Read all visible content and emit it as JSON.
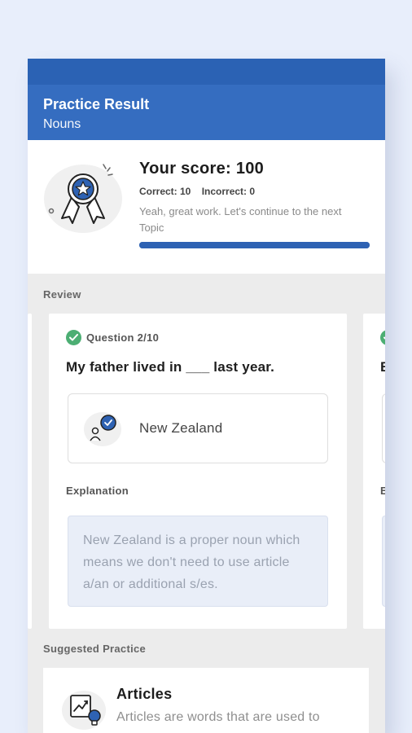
{
  "header": {
    "title": "Practice Result",
    "subtitle": "Nouns"
  },
  "score": {
    "title": "Your score: 100",
    "correct": "Correct: 10",
    "incorrect": "Incorrect: 0",
    "message": "Yeah, great work. Let's continue to the next Topic",
    "progress": 1.0
  },
  "review": {
    "label": "Review",
    "cards": [
      {
        "question_number": "Question 2/10",
        "question": "My father lived in ___ last year.",
        "answer": "New Zealand",
        "explanation_label": "Explanation",
        "explanation": "New Zealand is a proper noun which means we don't need to use article a/an or additional s/es."
      },
      {
        "question_fragment": "B",
        "explanation_fragment": "E"
      }
    ]
  },
  "suggested": {
    "label": "Suggested Practice",
    "items": [
      {
        "title": "Articles",
        "description": "Articles are words that are used to"
      }
    ]
  },
  "colors": {
    "primary": "#356dc0",
    "status_bar": "#2b62b4",
    "progress": "#2e62b3",
    "correct": "#4cae73"
  },
  "icons": [
    "ribbon-badge-icon",
    "check-circle-icon",
    "user-speech-icon",
    "chart-bulb-icon"
  ]
}
